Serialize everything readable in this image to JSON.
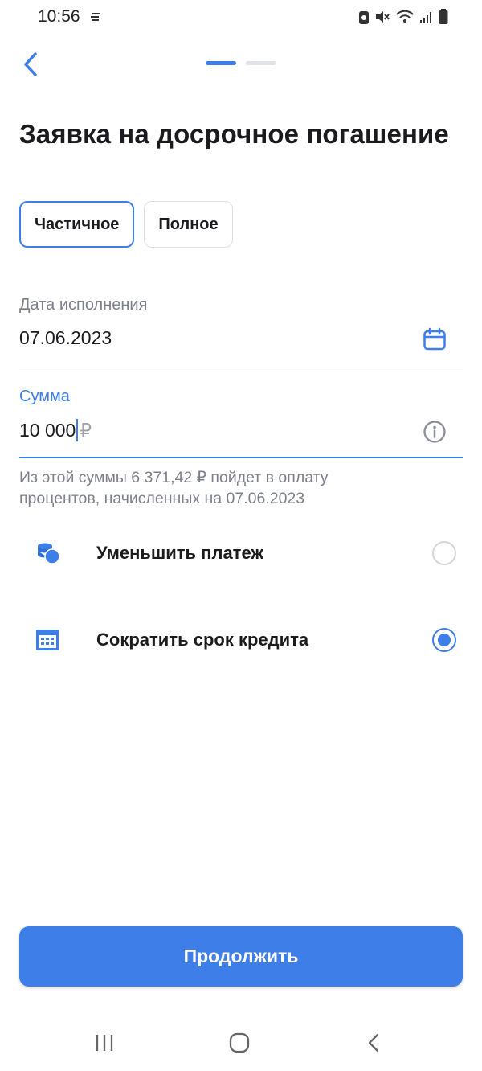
{
  "status_bar": {
    "time": "10:56"
  },
  "header": {
    "back_icon": "chevron-left-icon",
    "steps_total": 2,
    "steps_current": 1
  },
  "title": "Заявка на досрочное погашение",
  "repayment_type": {
    "options": [
      "Частичное",
      "Полное"
    ],
    "selected": "Частичное"
  },
  "date_field": {
    "label": "Дата исполнения",
    "value": "07.06.2023",
    "icon": "calendar-icon"
  },
  "amount_field": {
    "label": "Сумма",
    "value": "10 000",
    "currency": "₽",
    "icon": "info-icon"
  },
  "hint": "Из этой суммы 6 371,42 ₽ пойдет в оплату процентов, начисленных на 07.06.2023",
  "options": [
    {
      "label": "Уменьшить платеж",
      "icon": "coins-icon",
      "checked": false
    },
    {
      "label": "Сократить срок кредита",
      "icon": "calendar-grid-icon",
      "checked": true
    }
  ],
  "continue_label": "Продолжить",
  "colors": {
    "accent": "#3d7ee8",
    "text": "#1b1b1f",
    "secondary_text": "#7d808a"
  }
}
